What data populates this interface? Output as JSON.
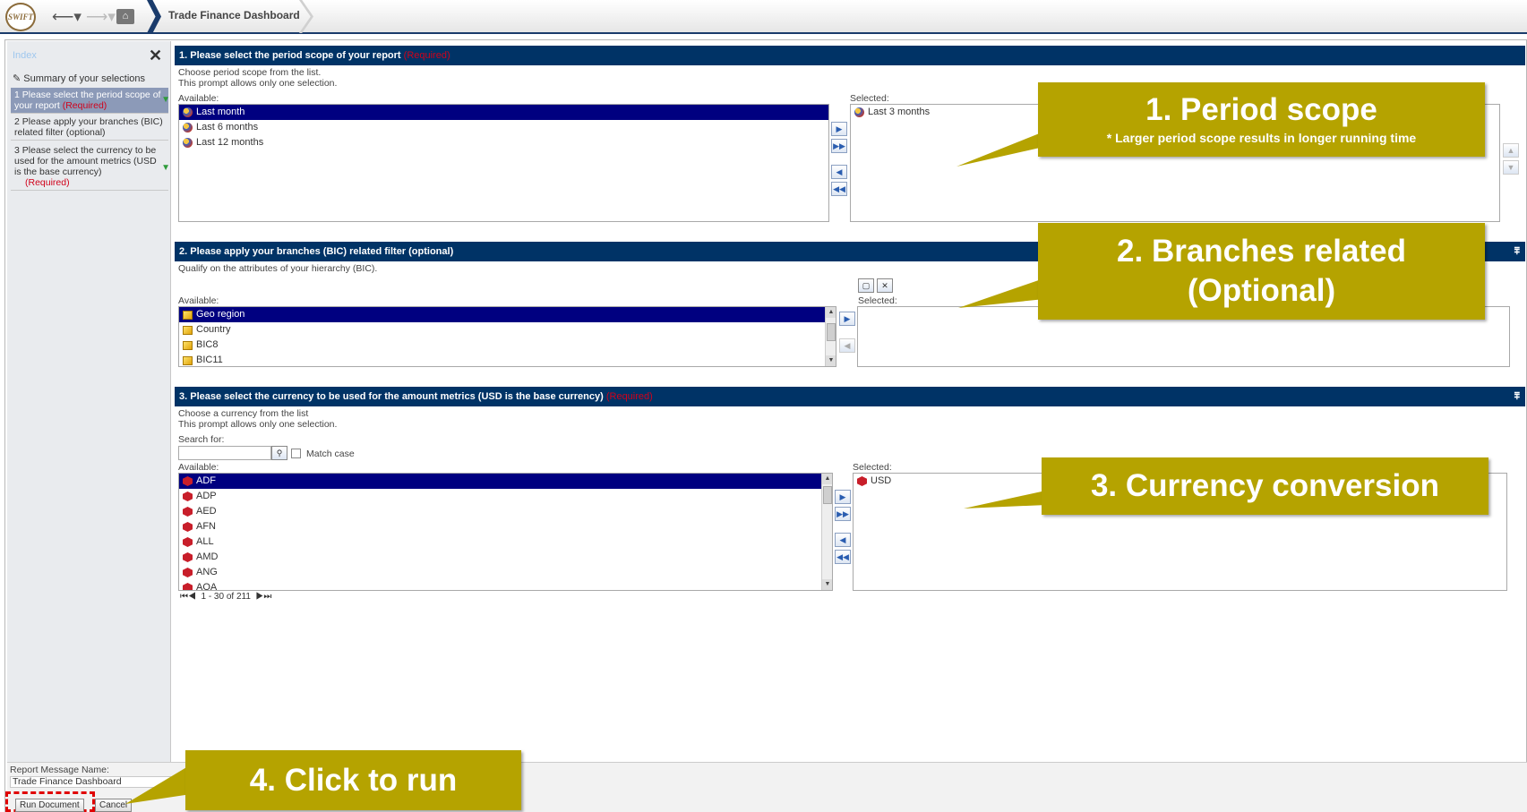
{
  "app": {
    "logo_text": "SWIFT",
    "breadcrumb": "Trade Finance Dashboard"
  },
  "sidebar": {
    "title": "Index",
    "summary": "Summary of your selections",
    "steps": [
      {
        "num": "1",
        "text": "Please select the period scope of your report",
        "req": "(Required)"
      },
      {
        "num": "2",
        "text": "Please apply your branches (BIC) related filter (optional)",
        "req": ""
      },
      {
        "num": "3",
        "text": "Please select the currency to be used for the amount metrics (USD is the base currency)",
        "req": "(Required)"
      }
    ]
  },
  "section1": {
    "title": "1.  Please select the period scope of your report",
    "req": "(Required)",
    "desc1": "Choose period scope from the list.",
    "desc2": "This prompt allows only one selection.",
    "available_label": "Available:",
    "selected_label": "Selected:",
    "available": [
      "Last month",
      "Last 6 months",
      "Last 12 months"
    ],
    "selected": [
      "Last 3 months"
    ]
  },
  "section2": {
    "title": "2.  Please apply your branches (BIC) related filter (optional)",
    "desc1": "Qualify on the attributes of your hierarchy (BIC).",
    "available_label": "Available:",
    "selected_label": "Selected:",
    "available": [
      "Geo region",
      "Country",
      "BIC8",
      "BIC11"
    ]
  },
  "section3": {
    "title": "3.  Please select the currency to be used for the amount metrics (USD is the base currency)",
    "req": "(Required)",
    "desc1": "Choose a currency from the list",
    "desc2": "This prompt allows only one selection.",
    "search_label": "Search for:",
    "match_case": "Match case",
    "available_label": "Available:",
    "selected_label": "Selected:",
    "available": [
      "ADF",
      "ADP",
      "AED",
      "AFN",
      "ALL",
      "AMD",
      "ANG",
      "AOA"
    ],
    "selected": [
      "USD"
    ],
    "pager": "1 - 30 of 211"
  },
  "footer": {
    "name_label": "Report Message Name:",
    "name_value": "Trade Finance Dashboard",
    "run_label": "Run Document",
    "cancel_label": "Cancel"
  },
  "callouts": {
    "c1_title": "1.    Period scope",
    "c1_sub": "* Larger period scope results in longer running time",
    "c2_line1": "2. Branches related",
    "c2_line2": "(Optional)",
    "c3": "3. Currency conversion",
    "c4": "4. Click to run"
  },
  "colors": {
    "header_blue": "#003366",
    "callout_olive": "#b5a300",
    "selection_navy": "#000080",
    "required_red": "#d0021b"
  }
}
